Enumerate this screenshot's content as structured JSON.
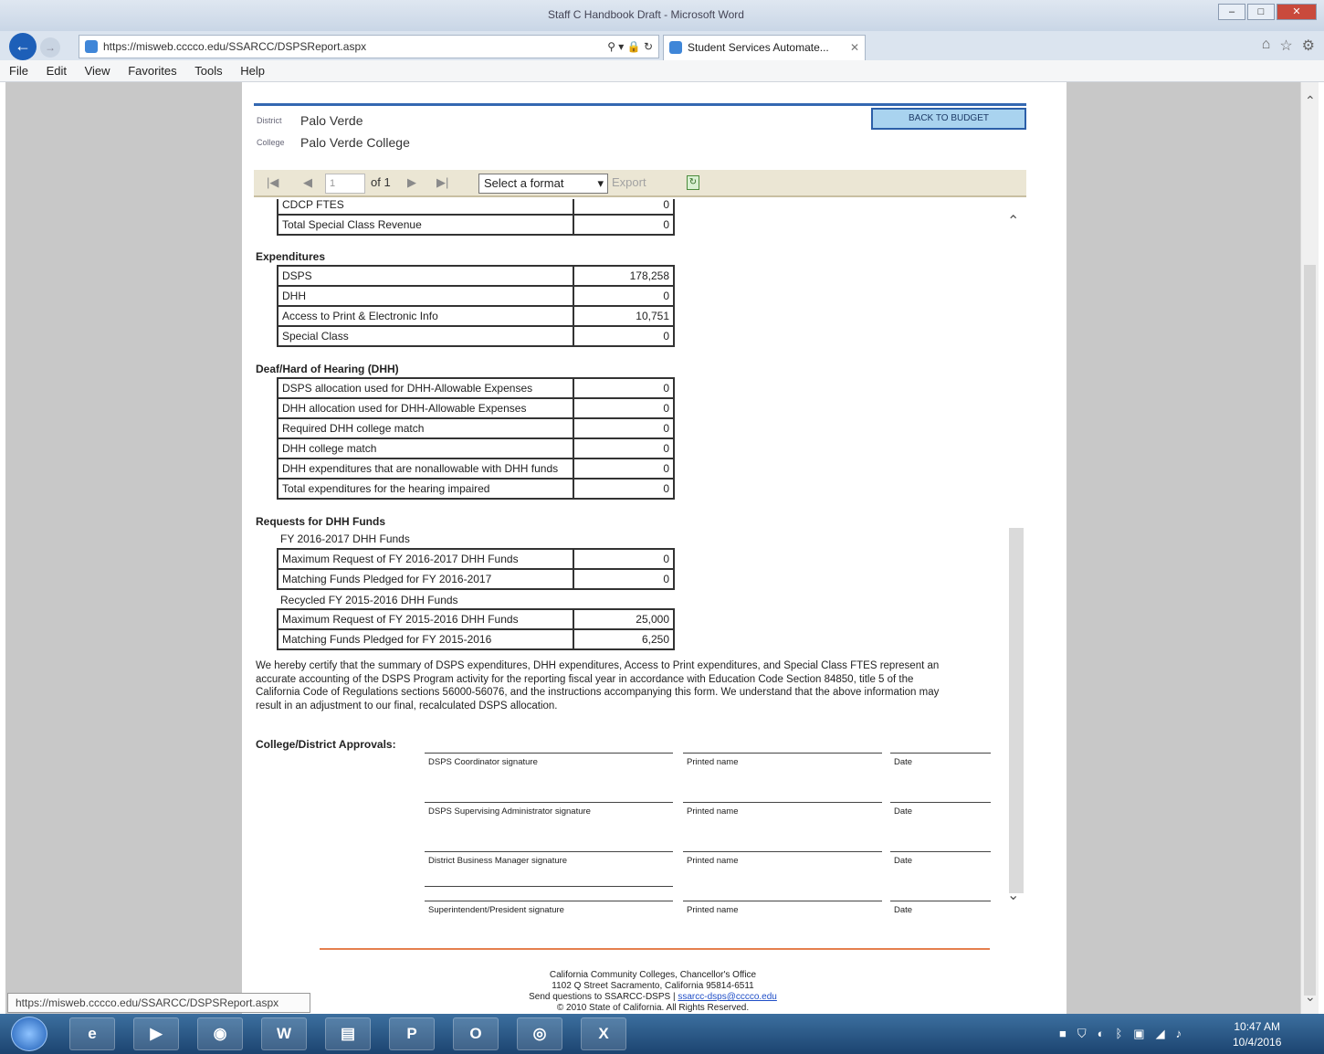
{
  "browser": {
    "title": "Staff C Handbook Draft - Microsoft Word",
    "url": "https://misweb.cccco.edu/SSARCC/DSPSReport.aspx",
    "tab_title": "Student Services Automate...",
    "menu": [
      "File",
      "Edit",
      "View",
      "Favorites",
      "Tools",
      "Help"
    ],
    "status_url": "https://misweb.cccco.edu/SSARCC/DSPSReport.aspx"
  },
  "header": {
    "district_label": "District",
    "district_value": "Palo Verde",
    "college_label": "College",
    "college_value": "Palo Verde College",
    "back_button": "BACK TO BUDGET"
  },
  "toolbar": {
    "page_value": "1",
    "of_label": "of 1",
    "format_select": "Select a format",
    "export_label": "Export"
  },
  "report": {
    "top_rows": [
      {
        "label": "CDCP FTES",
        "value": "0"
      },
      {
        "label": "Total Special Class Revenue",
        "value": "0"
      }
    ],
    "expenditures": {
      "title": "Expenditures",
      "rows": [
        {
          "label": "DSPS",
          "value": "178,258"
        },
        {
          "label": "DHH",
          "value": "0"
        },
        {
          "label": "Access to Print & Electronic Info",
          "value": "10,751"
        },
        {
          "label": "Special Class",
          "value": "0"
        }
      ]
    },
    "dhh": {
      "title": "Deaf/Hard of Hearing (DHH)",
      "rows": [
        {
          "label": "DSPS allocation used for DHH-Allowable Expenses",
          "value": "0"
        },
        {
          "label": "DHH allocation used for DHH-Allowable Expenses",
          "value": "0"
        },
        {
          "label": "Required DHH college match",
          "value": "0"
        },
        {
          "label": "DHH college match",
          "value": "0"
        },
        {
          "label": "DHH expenditures that are nonallowable with DHH funds",
          "value": "0"
        },
        {
          "label": "Total expenditures for the hearing impaired",
          "value": "0"
        }
      ]
    },
    "requests": {
      "title": "Requests for DHH Funds",
      "fy_heading": "FY 2016-2017 DHH Funds",
      "fy_rows": [
        {
          "label": "Maximum Request of FY 2016-2017 DHH Funds",
          "value": "0"
        },
        {
          "label": "Matching Funds Pledged for FY 2016-2017",
          "value": "0"
        }
      ],
      "recycled_heading": "Recycled FY 2015-2016 DHH Funds",
      "recycled_rows": [
        {
          "label": "Maximum Request of FY 2015-2016 DHH Funds",
          "value": "25,000"
        },
        {
          "label": "Matching Funds Pledged for FY 2015-2016",
          "value": "6,250"
        }
      ]
    },
    "certification": "We hereby certify that the summary of DSPS expenditures, DHH expenditures, Access to Print expenditures, and Special Class FTES represent an accurate accounting of the DSPS Program activity for the reporting fiscal year in accordance with Education Code Section 84850, title 5 of the California Code of Regulations sections 56000-56076, and the instructions accompanying this form. We understand that the above information may result in an adjustment to our final, recalculated DSPS allocation.",
    "approvals_title": "College/District Approvals:",
    "signatures": [
      {
        "role": "DSPS Coordinator signature",
        "printed": "Printed name",
        "date": "Date"
      },
      {
        "role": "DSPS Supervising Administrator signature",
        "printed": "Printed name",
        "date": "Date"
      },
      {
        "role": "District Business Manager signature",
        "printed": "Printed name",
        "date": "Date"
      },
      {
        "role": "Superintendent/President signature",
        "printed": "Printed name",
        "date": "Date"
      }
    ]
  },
  "footer": {
    "line1": "California Community Colleges, Chancellor's Office",
    "line2": "1102 Q Street Sacramento, California 95814-6511",
    "line3_prefix": "Send questions to SSARCC-DSPS |",
    "email": "ssarcc-dsps@cccco.edu",
    "line4": "© 2010 State of California. All Rights Reserved."
  },
  "taskbar": {
    "time": "10:47 AM",
    "date": "10/4/2016"
  }
}
